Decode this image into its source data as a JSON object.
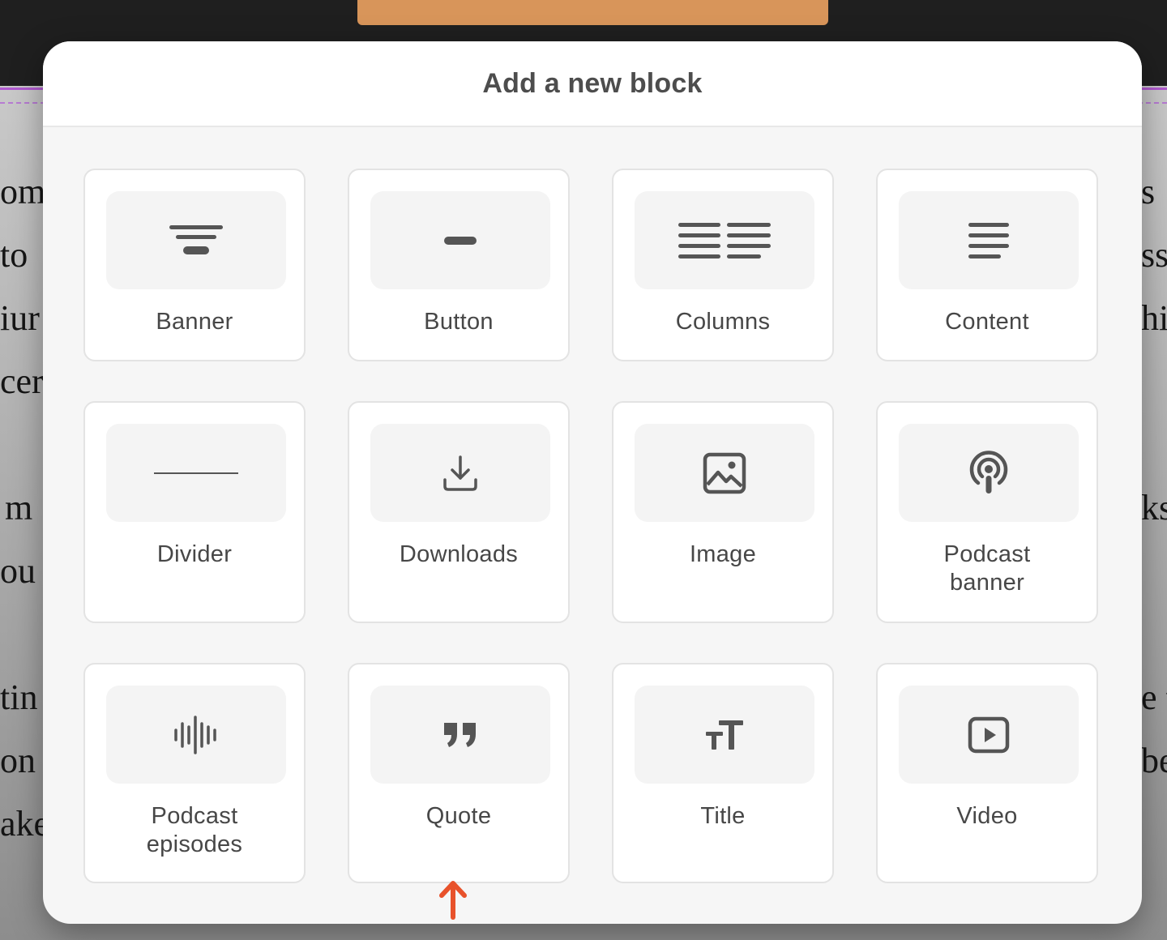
{
  "modal": {
    "title": "Add a new block"
  },
  "blocks": [
    {
      "label": "Banner",
      "icon": "banner-icon"
    },
    {
      "label": "Button",
      "icon": "button-icon"
    },
    {
      "label": "Columns",
      "icon": "columns-icon"
    },
    {
      "label": "Content",
      "icon": "content-icon"
    },
    {
      "label": "Divider",
      "icon": "divider-icon"
    },
    {
      "label": "Downloads",
      "icon": "download-icon"
    },
    {
      "label": "Image",
      "icon": "image-icon"
    },
    {
      "label": "Podcast\nbanner",
      "icon": "podcast-icon"
    },
    {
      "label": "Podcast\nepisodes",
      "icon": "audio-waveform-icon"
    },
    {
      "label": "Quote",
      "icon": "quote-icon"
    },
    {
      "label": "Title",
      "icon": "text-size-icon"
    },
    {
      "label": "Video",
      "icon": "play-video-icon"
    }
  ],
  "background_text": {
    "left": [
      "om",
      "to",
      "iur",
      "cer",
      "m",
      "ou",
      "tin",
      "on w",
      "ake"
    ],
    "right": [
      "s",
      "ss",
      "hi",
      "ks",
      "e t",
      "be"
    ]
  },
  "colors": {
    "accent_tab": "#d8955a",
    "guide_line": "#b15ad0",
    "arrow": "#e8522b",
    "icon": "#555555"
  }
}
